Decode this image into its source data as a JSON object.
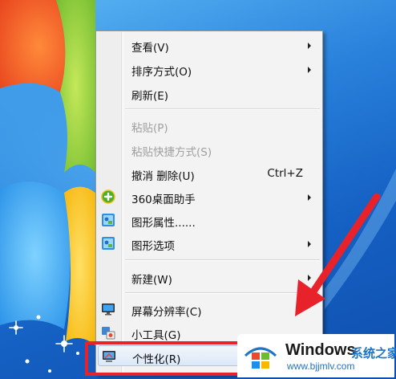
{
  "context_menu": {
    "items": [
      {
        "label": "查看(V)"
      },
      {
        "label": "排序方式(O)"
      },
      {
        "label": "刷新(E)"
      },
      {
        "label": "粘贴(P)"
      },
      {
        "label": "粘贴快捷方式(S)"
      },
      {
        "label": "撤消 删除(U)",
        "shortcut": "Ctrl+Z"
      },
      {
        "label": "360桌面助手",
        "icon": "360-assistant-icon"
      },
      {
        "label": "图形属性......",
        "icon": "graphics-properties-icon"
      },
      {
        "label": "图形选项",
        "icon": "graphics-options-icon"
      },
      {
        "label": "新建(W)"
      },
      {
        "label": "屏幕分辨率(C)",
        "icon": "monitor-icon"
      },
      {
        "label": "小工具(G)",
        "icon": "gadgets-icon"
      },
      {
        "label": "个性化(R)",
        "icon": "personalize-icon"
      }
    ]
  },
  "watermark": {
    "brand": "Windows",
    "suffix": "系统之家",
    "url": "www.bjjmlv.com"
  },
  "colors": {
    "annotation_red": "#e8222a",
    "menu_background": "#f3f3f3",
    "watermark_blue": "#1e74c8"
  }
}
